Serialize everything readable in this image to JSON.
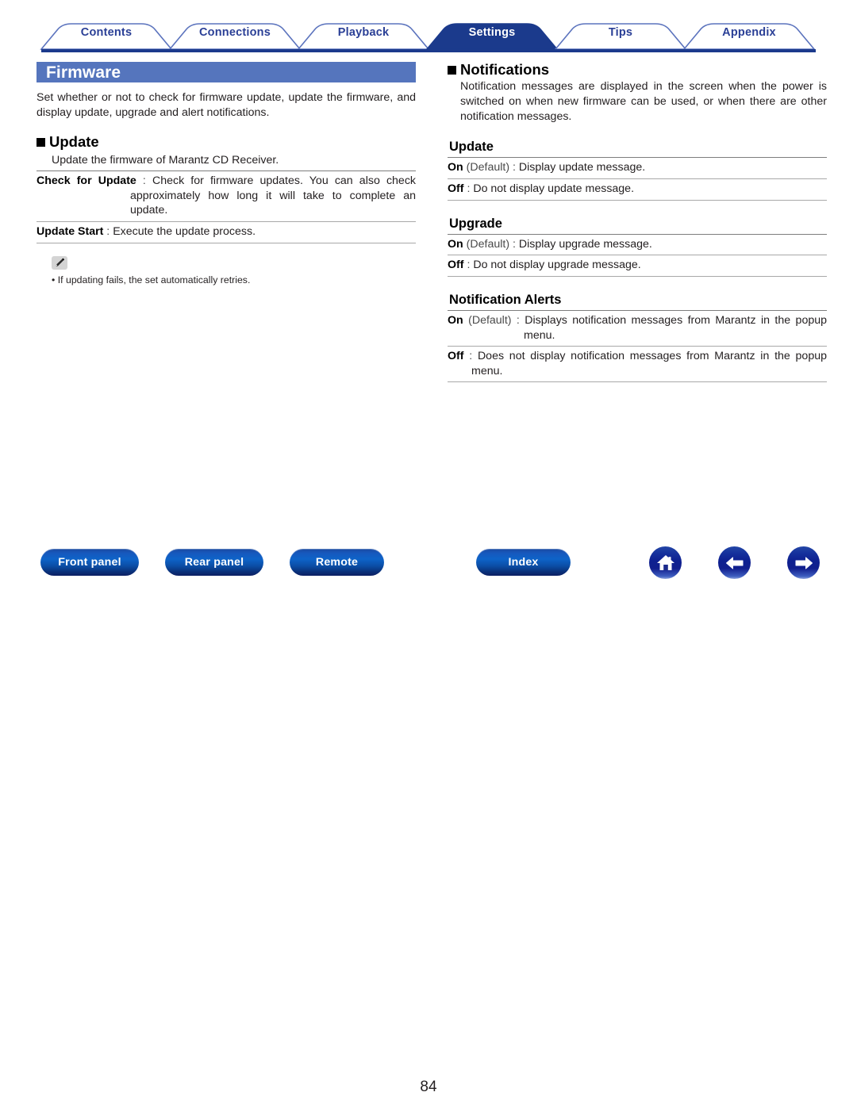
{
  "tabs": [
    {
      "label": "Contents",
      "active": false
    },
    {
      "label": "Connections",
      "active": false
    },
    {
      "label": "Playback",
      "active": false
    },
    {
      "label": "Settings",
      "active": true
    },
    {
      "label": "Tips",
      "active": false
    },
    {
      "label": "Appendix",
      "active": false
    }
  ],
  "left": {
    "title": "Firmware",
    "lead": "Set whether or not to check for firmware update, update the firmware, and display update, upgrade and alert notifications.",
    "update_section": {
      "heading": "Update",
      "description": "Update the firmware of Marantz CD Receiver.",
      "rows": [
        {
          "term": "Check for Update",
          "sep": " : ",
          "desc": "Check for firmware updates. You can also check approximately how long it will take to complete an update."
        },
        {
          "term": "Update Start",
          "sep": " : ",
          "desc": "Execute the update process."
        }
      ]
    },
    "note": {
      "icon": "pencil-note-icon",
      "items": [
        "If updating fails, the set automatically retries."
      ]
    }
  },
  "right": {
    "heading": "Notifications",
    "lead": "Notification messages are displayed in the screen when the power is switched on when new firmware can be used, or when there are other notification messages.",
    "sections": [
      {
        "heading": "Update",
        "rows": [
          {
            "term": "On",
            "default_tag": " (Default)",
            "sep": " : ",
            "desc": "Display update message."
          },
          {
            "term": "Off",
            "default_tag": "",
            "sep": " : ",
            "desc": "Do not display update message."
          }
        ]
      },
      {
        "heading": "Upgrade",
        "rows": [
          {
            "term": "On",
            "default_tag": " (Default)",
            "sep": " : ",
            "desc": "Display upgrade message."
          },
          {
            "term": "Off",
            "default_tag": "",
            "sep": " : ",
            "desc": "Do not display upgrade message."
          }
        ]
      },
      {
        "heading": "Notification Alerts",
        "rows": [
          {
            "term": "On",
            "default_tag": " (Default)",
            "sep": " : ",
            "desc": "Displays notification messages from Marantz in the popup menu."
          },
          {
            "term": "Off",
            "default_tag": "",
            "sep": " : ",
            "desc": "Does not display notification messages from Marantz in the popup menu."
          }
        ]
      }
    ]
  },
  "footer": {
    "buttons": [
      {
        "label": "Front panel"
      },
      {
        "label": "Rear panel"
      },
      {
        "label": "Remote"
      },
      {
        "label": "Index"
      }
    ],
    "page_number": "84",
    "icons": [
      {
        "name": "home-icon"
      },
      {
        "name": "arrow-left-icon"
      },
      {
        "name": "arrow-right-icon"
      }
    ]
  },
  "colors": {
    "tab_active_fill": "#1b3a8c",
    "tab_outline": "#5b73bd",
    "tab_text": "#2a3f96",
    "title_band": "#5575bd",
    "rule_navy": "#1b3a8c",
    "button_blue": "#0e63c8"
  }
}
